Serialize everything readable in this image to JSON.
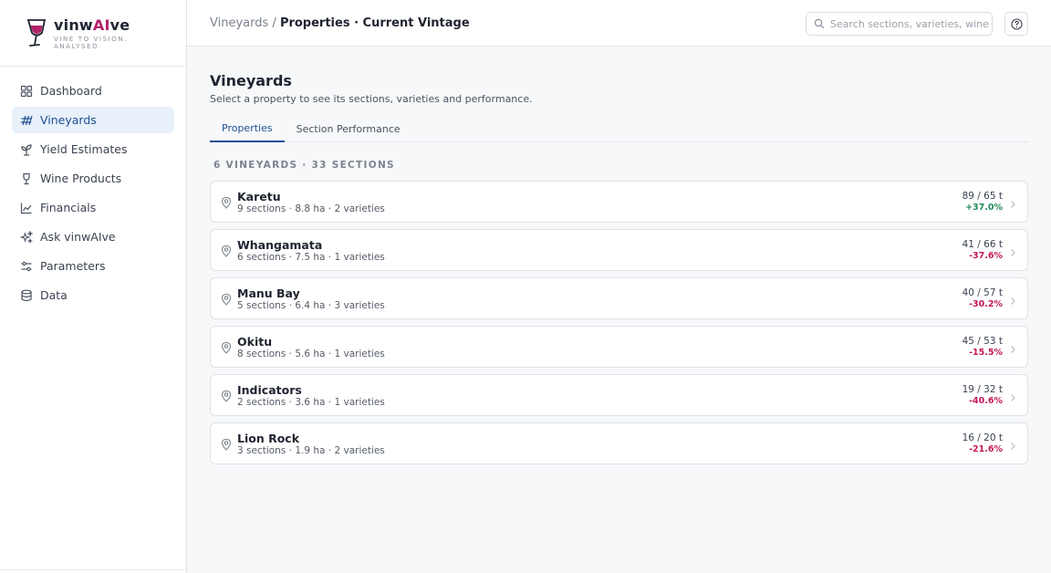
{
  "brand": {
    "name_pre": "vinw",
    "name_ai": "AI",
    "name_post": "ve",
    "tagline": "VINE TO VISION. ANALYSED.",
    "accent": "#b5226b"
  },
  "sidebar": {
    "items": [
      {
        "label": "Dashboard",
        "icon": "grid-icon",
        "active": false
      },
      {
        "label": "Vineyards",
        "icon": "vineyard-icon",
        "active": true
      },
      {
        "label": "Yield Estimates",
        "icon": "sprout-icon",
        "active": false
      },
      {
        "label": "Wine Products",
        "icon": "wine-glass-icon",
        "active": false
      },
      {
        "label": "Financials",
        "icon": "line-chart-icon",
        "active": false
      },
      {
        "label": "Ask vinwAIve",
        "icon": "sparkles-icon",
        "active": false
      },
      {
        "label": "Parameters",
        "icon": "sliders-icon",
        "active": false
      },
      {
        "label": "Data",
        "icon": "database-icon",
        "active": false
      }
    ]
  },
  "header": {
    "breadcrumb_root": "Vineyards",
    "breadcrumb_sep": "/",
    "breadcrumb_current": "Properties · Current Vintage",
    "search_placeholder": "Search sections, varieties, wine products...",
    "search_value": ""
  },
  "main": {
    "title": "Vineyards",
    "subtitle": "Select a property to see its sections, varieties and performance.",
    "tabs": [
      {
        "label": "Properties",
        "active": true
      },
      {
        "label": "Section Performance",
        "active": false
      }
    ],
    "count_label": "6 VINEYARDS · 33 SECTIONS",
    "vineyards": [
      {
        "name": "Karetu",
        "meta": "9 sections · 8.8 ha · 2 varieties",
        "tons": "89 / 65 t",
        "pct": "+37.0%",
        "trend": "pos"
      },
      {
        "name": "Whangamata",
        "meta": "6 sections · 7.5 ha · 1 varieties",
        "tons": "41 / 66 t",
        "pct": "-37.6%",
        "trend": "neg"
      },
      {
        "name": "Manu Bay",
        "meta": "5 sections · 6.4 ha · 3 varieties",
        "tons": "40 / 57 t",
        "pct": "-30.2%",
        "trend": "neg"
      },
      {
        "name": "Okitu",
        "meta": "8 sections · 5.6 ha · 1 varieties",
        "tons": "45 / 53 t",
        "pct": "-15.5%",
        "trend": "neg"
      },
      {
        "name": "Indicators",
        "meta": "2 sections · 3.6 ha · 1 varieties",
        "tons": "19 / 32 t",
        "pct": "-40.6%",
        "trend": "neg"
      },
      {
        "name": "Lion Rock",
        "meta": "3 sections · 1.9 ha · 2 varieties",
        "tons": "16 / 20 t",
        "pct": "-21.6%",
        "trend": "neg"
      }
    ]
  },
  "colors": {
    "active_nav_bg": "#e8f0fa",
    "active_accent": "#1d4f91",
    "positive": "#1e8a57",
    "negative": "#c2185b"
  }
}
